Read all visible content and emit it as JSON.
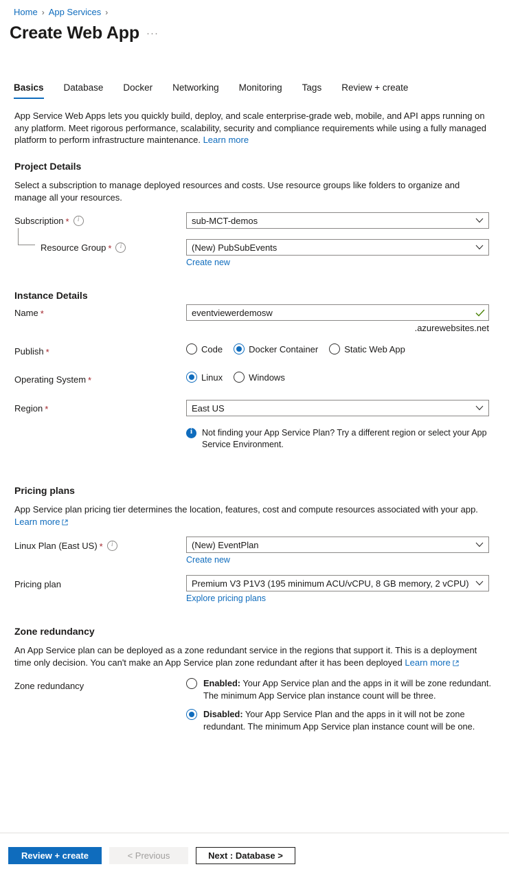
{
  "breadcrumb": {
    "items": [
      {
        "label": "Home"
      },
      {
        "label": "App Services"
      }
    ],
    "separator": "›"
  },
  "header": {
    "title": "Create Web App",
    "more_menu": "···"
  },
  "tabs": [
    {
      "label": "Basics",
      "active": true
    },
    {
      "label": "Database",
      "active": false
    },
    {
      "label": "Docker",
      "active": false
    },
    {
      "label": "Networking",
      "active": false
    },
    {
      "label": "Monitoring",
      "active": false
    },
    {
      "label": "Tags",
      "active": false
    },
    {
      "label": "Review + create",
      "active": false
    }
  ],
  "intro": {
    "text": "App Service Web Apps lets you quickly build, deploy, and scale enterprise-grade web, mobile, and API apps running on any platform. Meet rigorous performance, scalability, security and compliance requirements while using a fully managed platform to perform infrastructure maintenance.",
    "learn_more": "Learn more"
  },
  "project_details": {
    "heading": "Project Details",
    "description": "Select a subscription to manage deployed resources and costs. Use resource groups like folders to organize and manage all your resources.",
    "subscription": {
      "label": "Subscription",
      "required": "*",
      "value": "sub-MCT-demos"
    },
    "resource_group": {
      "label": "Resource Group",
      "required": "*",
      "value": "(New) PubSubEvents",
      "create_new": "Create new"
    }
  },
  "instance_details": {
    "heading": "Instance Details",
    "name": {
      "label": "Name",
      "required": "*",
      "value": "eventviewerdemosw",
      "suffix": ".azurewebsites.net",
      "validation": "valid"
    },
    "publish": {
      "label": "Publish",
      "required": "*",
      "options": [
        {
          "label": "Code",
          "selected": false
        },
        {
          "label": "Docker Container",
          "selected": true
        },
        {
          "label": "Static Web App",
          "selected": false
        }
      ]
    },
    "operating_system": {
      "label": "Operating System",
      "required": "*",
      "options": [
        {
          "label": "Linux",
          "selected": true
        },
        {
          "label": "Windows",
          "selected": false
        }
      ]
    },
    "region": {
      "label": "Region",
      "required": "*",
      "value": "East US",
      "info_message": "Not finding your App Service Plan? Try a different region or select your App Service Environment."
    }
  },
  "pricing_plans": {
    "heading": "Pricing plans",
    "description": "App Service plan pricing tier determines the location, features, cost and compute resources associated with your app.",
    "learn_more": "Learn more",
    "linux_plan": {
      "label": "Linux Plan (East US)",
      "required": "*",
      "value": "(New) EventPlan",
      "create_new": "Create new"
    },
    "pricing_plan": {
      "label": "Pricing plan",
      "value": "Premium V3 P1V3 (195 minimum ACU/vCPU, 8 GB memory, 2 vCPU)",
      "explore_link": "Explore pricing plans"
    }
  },
  "zone_redundancy": {
    "heading": "Zone redundancy",
    "description": "An App Service plan can be deployed as a zone redundant service in the regions that support it. This is a deployment time only decision. You can't make an App Service plan zone redundant after it has been deployed",
    "learn_more": "Learn more",
    "field_label": "Zone redundancy",
    "options": [
      {
        "title": "Enabled:",
        "text": " Your App Service plan and the apps in it will be zone redundant. The minimum App Service plan instance count will be three.",
        "selected": false
      },
      {
        "title": "Disabled:",
        "text": " Your App Service Plan and the apps in it will not be zone redundant. The minimum App Service plan instance count will be one.",
        "selected": true
      }
    ]
  },
  "footer": {
    "review_create": "Review + create",
    "previous": "< Previous",
    "next": "Next : Database >"
  },
  "colors": {
    "accent": "#0f6cbd",
    "required": "#a4262c",
    "valid": "#498205",
    "border": "#8a8886"
  }
}
